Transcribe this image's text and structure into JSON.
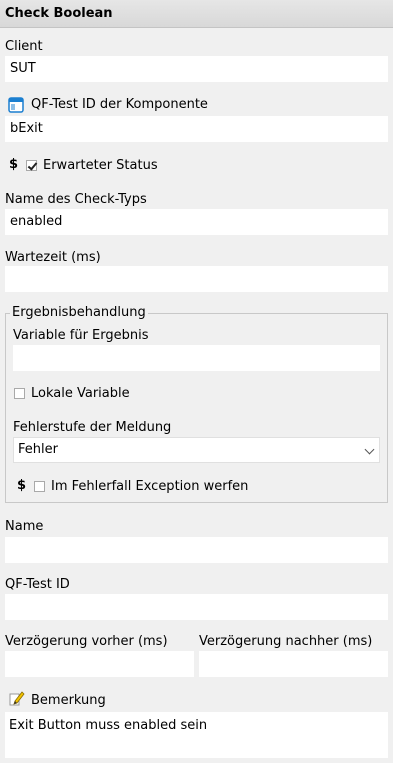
{
  "header": {
    "title": "Check Boolean"
  },
  "client": {
    "label": "Client",
    "value": "SUT"
  },
  "component": {
    "label": "QF-Test ID der Komponente",
    "value": "bExit",
    "icon": "component-window-icon"
  },
  "expected_status": {
    "dollar": "$",
    "label": "Erwarteter Status",
    "checked": true
  },
  "check_type": {
    "label": "Name des Check-Typs",
    "value": "enabled"
  },
  "wait_time": {
    "label": "Wartezeit (ms)",
    "value": ""
  },
  "result_group": {
    "title": "Ergebnisbehandlung",
    "variable": {
      "label": "Variable für Ergebnis",
      "value": ""
    },
    "local_variable": {
      "label": "Lokale Variable",
      "checked": false
    },
    "error_level": {
      "label": "Fehlerstufe der Meldung",
      "selected": "Fehler"
    },
    "exception": {
      "dollar": "$",
      "label": "Im Fehlerfall Exception werfen",
      "checked": false
    }
  },
  "name": {
    "label": "Name",
    "value": ""
  },
  "qftest_id": {
    "label": "QF-Test ID",
    "value": ""
  },
  "delay_before": {
    "label": "Verzögerung vorher (ms)",
    "value": ""
  },
  "delay_after": {
    "label": "Verzögerung nachher (ms)",
    "value": ""
  },
  "comment": {
    "label": "Bemerkung",
    "value": "Exit Button muss enabled sein",
    "icon": "pencil-note-icon"
  }
}
